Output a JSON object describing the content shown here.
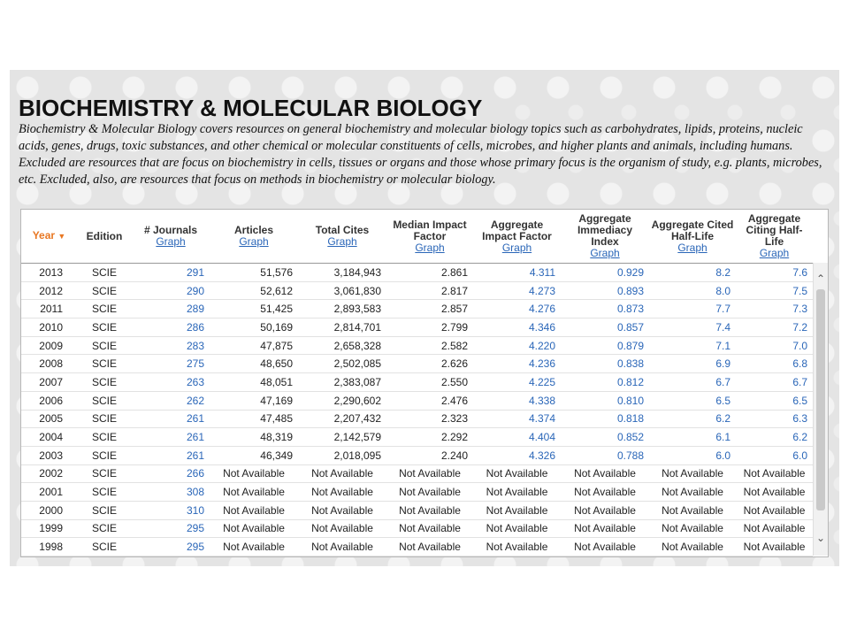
{
  "page": {
    "title": "BIOCHEMISTRY & MOLECULAR BIOLOGY",
    "description": "Biochemistry & Molecular Biology covers resources on general biochemistry and molecular biology topics such as carbohydrates, lipids, proteins, nucleic acids, genes, drugs, toxic substances, and other chemical or molecular constituents of cells, microbes, and higher plants and animals, including humans. Excluded are resources that are focus on biochemistry in cells, tissues or organs and those whose primary focus is the organism of study, e.g. plants, microbes, etc. Excluded, also, are resources that focus on methods in biochemistry or molecular biology."
  },
  "table": {
    "headers": {
      "year": "Year",
      "edition": "Edition",
      "journals": "# Journals",
      "articles": "Articles",
      "total_cites": "Total Cites",
      "median_if": "Median Impact Factor",
      "aggregate_if": "Aggregate Impact Factor",
      "aggregate_immediacy": "Aggregate Immediacy Index",
      "aggregate_cited_hl": "Aggregate Cited Half-Life",
      "aggregate_citing_hl": "Aggregate Citing Half-Life"
    },
    "graph_link": "Graph",
    "rows": [
      [
        "2013",
        "SCIE",
        "291",
        "51,576",
        "3,184,943",
        "2.861",
        "4.311",
        "0.929",
        "8.2",
        "7.6"
      ],
      [
        "2012",
        "SCIE",
        "290",
        "52,612",
        "3,061,830",
        "2.817",
        "4.273",
        "0.893",
        "8.0",
        "7.5"
      ],
      [
        "2011",
        "SCIE",
        "289",
        "51,425",
        "2,893,583",
        "2.857",
        "4.276",
        "0.873",
        "7.7",
        "7.3"
      ],
      [
        "2010",
        "SCIE",
        "286",
        "50,169",
        "2,814,701",
        "2.799",
        "4.346",
        "0.857",
        "7.4",
        "7.2"
      ],
      [
        "2009",
        "SCIE",
        "283",
        "47,875",
        "2,658,328",
        "2.582",
        "4.220",
        "0.879",
        "7.1",
        "7.0"
      ],
      [
        "2008",
        "SCIE",
        "275",
        "48,650",
        "2,502,085",
        "2.626",
        "4.236",
        "0.838",
        "6.9",
        "6.8"
      ],
      [
        "2007",
        "SCIE",
        "263",
        "48,051",
        "2,383,087",
        "2.550",
        "4.225",
        "0.812",
        "6.7",
        "6.7"
      ],
      [
        "2006",
        "SCIE",
        "262",
        "47,169",
        "2,290,602",
        "2.476",
        "4.338",
        "0.810",
        "6.5",
        "6.5"
      ],
      [
        "2005",
        "SCIE",
        "261",
        "47,485",
        "2,207,432",
        "2.323",
        "4.374",
        "0.818",
        "6.2",
        "6.3"
      ],
      [
        "2004",
        "SCIE",
        "261",
        "48,319",
        "2,142,579",
        "2.292",
        "4.404",
        "0.852",
        "6.1",
        "6.2"
      ],
      [
        "2003",
        "SCIE",
        "261",
        "46,349",
        "2,018,095",
        "2.240",
        "4.326",
        "0.788",
        "6.0",
        "6.0"
      ],
      [
        "2002",
        "SCIE",
        "266",
        "Not Available",
        "Not Available",
        "Not Available",
        "Not Available",
        "Not Available",
        "Not Available",
        "Not Available"
      ],
      [
        "2001",
        "SCIE",
        "308",
        "Not Available",
        "Not Available",
        "Not Available",
        "Not Available",
        "Not Available",
        "Not Available",
        "Not Available"
      ],
      [
        "2000",
        "SCIE",
        "310",
        "Not Available",
        "Not Available",
        "Not Available",
        "Not Available",
        "Not Available",
        "Not Available",
        "Not Available"
      ],
      [
        "1999",
        "SCIE",
        "295",
        "Not Available",
        "Not Available",
        "Not Available",
        "Not Available",
        "Not Available",
        "Not Available",
        "Not Available"
      ],
      [
        "1998",
        "SCIE",
        "295",
        "Not Available",
        "Not Available",
        "Not Available",
        "Not Available",
        "Not Available",
        "Not Available",
        "Not Available"
      ]
    ]
  },
  "icons": {
    "sort": "sort-down-icon",
    "scroll_up": "chevron-up-icon",
    "scroll_down": "chevron-down-icon"
  },
  "colors": {
    "accent_orange": "#e87722",
    "link_blue": "#2a66b8"
  }
}
